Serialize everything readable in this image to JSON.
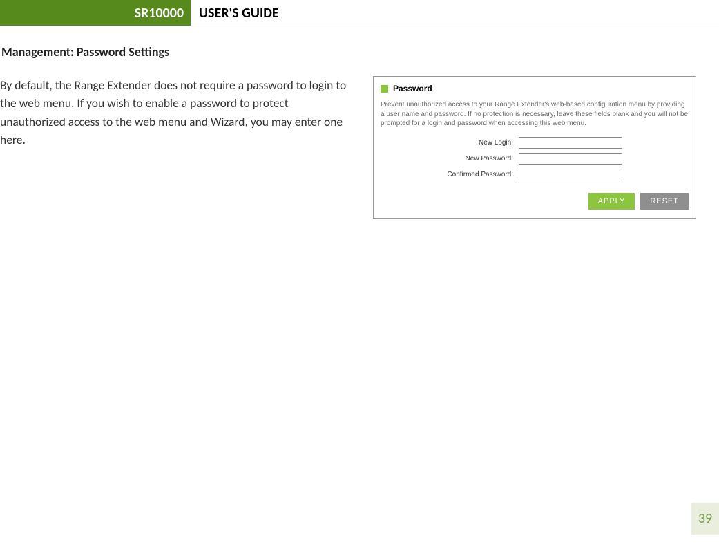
{
  "header": {
    "model": "SR10000",
    "title": "USER'S GUIDE"
  },
  "section_heading": "Management: Password Settings",
  "description": "By default, the Range Extender does not require a password to login to the web menu.  If you wish to enable a password to protect unauthorized access to the web menu and Wizard, you may enter one here.",
  "panel": {
    "title": "Password",
    "help": "Prevent unauthorized access to your Range Extender's web-based configuration menu by providing a user name and password. If no protection is necessary, leave these fields blank and you will not be prompted for a login and password when accessing this web menu.",
    "fields": {
      "new_login_label": "New Login:",
      "new_password_label": "New Password:",
      "confirmed_password_label": "Confirmed Password:"
    },
    "buttons": {
      "apply": "APPLY",
      "reset": "RESET"
    }
  },
  "page_number": "39"
}
